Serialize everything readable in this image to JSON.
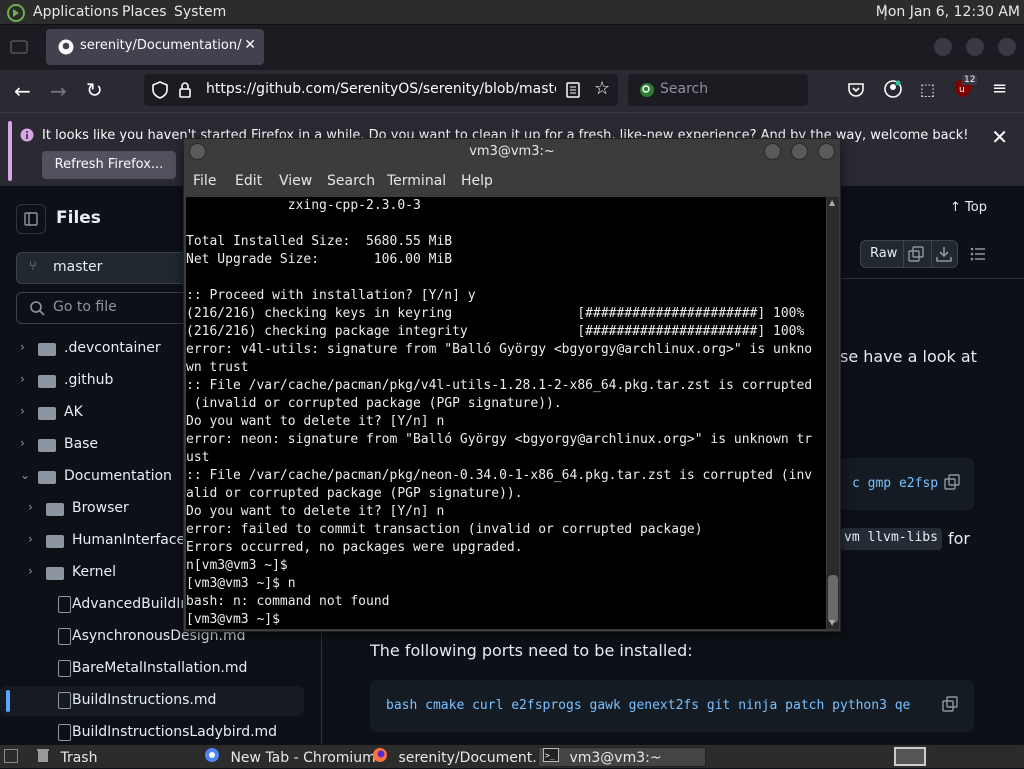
{
  "top_panel": {
    "menus": [
      "Applications",
      "Places",
      "System"
    ],
    "clock": "Mon Jan  6, 12:30 AM"
  },
  "firefox": {
    "tab_title": "serenity/Documentation/Bu",
    "url": "https://github.com/SerenityOS/serenity/blob/master/Do",
    "search_placeholder": "Search",
    "extension_badge": "12",
    "notice_text": "It looks like you haven't started Firefox in a while. Do you want to clean it up for a fresh, like-new experience? And by the way, welcome back!",
    "refresh_button": "Refresh Firefox..."
  },
  "github": {
    "files_title": "Files",
    "branch": "master",
    "goto_placeholder": "Go to file",
    "top_link": "Top",
    "raw_button": "Raw",
    "tree": [
      {
        "label": ".devcontainer",
        "type": "folder",
        "level": 0,
        "expanded": false
      },
      {
        "label": ".github",
        "type": "folder",
        "level": 0,
        "expanded": false
      },
      {
        "label": "AK",
        "type": "folder",
        "level": 0,
        "expanded": false
      },
      {
        "label": "Base",
        "type": "folder",
        "level": 0,
        "expanded": false
      },
      {
        "label": "Documentation",
        "type": "folder",
        "level": 0,
        "expanded": true
      },
      {
        "label": "Browser",
        "type": "folder",
        "level": 1,
        "expanded": false
      },
      {
        "label": "HumanInterfaceG",
        "type": "folder",
        "level": 1,
        "expanded": false
      },
      {
        "label": "Kernel",
        "type": "folder",
        "level": 1,
        "expanded": false
      },
      {
        "label": "AdvancedBuildIns",
        "type": "file",
        "level": 1
      },
      {
        "label": "AsynchronousDesign.md",
        "type": "file",
        "level": 1
      },
      {
        "label": "BareMetalInstallation.md",
        "type": "file",
        "level": 1
      },
      {
        "label": "BuildInstructions.md",
        "type": "file",
        "level": 1,
        "selected": true
      },
      {
        "label": "BuildInstructionsLadybird.md",
        "type": "file",
        "level": 1
      }
    ],
    "content_fragment_1": "se have a look at",
    "code_fragment_1": "c gmp e2fsp",
    "code_fragment_2": "vm llvm-libs",
    "text_fragment_for": "for",
    "ports_heading": "The following ports need to be installed:",
    "ports_code": "bash cmake curl e2fsprogs gawk genext2fs git ninja patch python3 qe"
  },
  "terminal": {
    "title": "vm3@vm3:~",
    "menu": [
      "File",
      "Edit",
      "View",
      "Search",
      "Terminal",
      "Help"
    ],
    "lines": [
      "             zxing-cpp-2.3.0-3",
      "",
      "Total Installed Size:  5680.55 MiB",
      "Net Upgrade Size:       106.00 MiB",
      "",
      ":: Proceed with installation? [Y/n] y",
      "(216/216) checking keys in keyring                [######################] 100%",
      "(216/216) checking package integrity              [######################] 100%",
      "error: v4l-utils: signature from \"Balló György <bgyorgy@archlinux.org>\" is unkno",
      "wn trust",
      ":: File /var/cache/pacman/pkg/v4l-utils-1.28.1-2-x86_64.pkg.tar.zst is corrupted",
      " (invalid or corrupted package (PGP signature)).",
      "Do you want to delete it? [Y/n] n",
      "error: neon: signature from \"Balló György <bgyorgy@archlinux.org>\" is unknown tr",
      "ust",
      ":: File /var/cache/pacman/pkg/neon-0.34.0-1-x86_64.pkg.tar.zst is corrupted (inv",
      "alid or corrupted package (PGP signature)).",
      "Do you want to delete it? [Y/n] n",
      "error: failed to commit transaction (invalid or corrupted package)",
      "Errors occurred, no packages were upgraded.",
      "n[vm3@vm3 ~]$",
      "[vm3@vm3 ~]$ n",
      "bash: n: command not found",
      "[vm3@vm3 ~]$ "
    ]
  },
  "taskbar": {
    "items": [
      "Trash",
      "New Tab - Chromium",
      "serenity/Document...",
      "vm3@vm3:~"
    ]
  },
  "colors": {
    "accent_blue": "#58a6ff",
    "notice_stripe": "#d6a6e6",
    "terminal_bg": "#000000"
  }
}
